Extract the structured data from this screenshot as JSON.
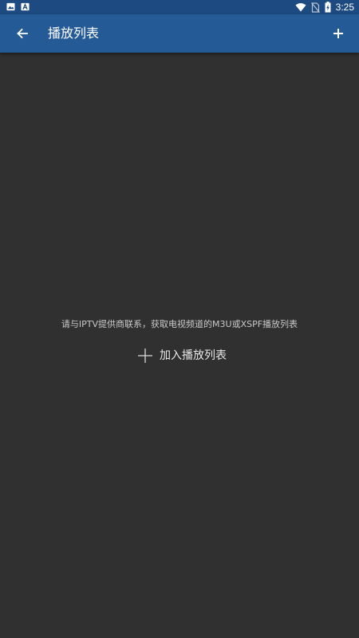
{
  "status_bar": {
    "time": "3:25",
    "left_icons": [
      "image-icon",
      "a-letter-icon"
    ],
    "right_icons": [
      "wifi-icon",
      "no-sim-icon",
      "battery-charging-icon"
    ]
  },
  "app_bar": {
    "back_icon": "arrow-left-icon",
    "title": "播放列表",
    "add_icon": "plus-icon"
  },
  "empty_state": {
    "message": "请与IPTV提供商联系，获取电视频道的M3U或XSPF播放列表",
    "action_icon": "plus-icon",
    "action_label": "加入播放列表"
  },
  "colors": {
    "status_bar": "#1d4a80",
    "app_bar": "#245a96",
    "background": "#303030"
  }
}
